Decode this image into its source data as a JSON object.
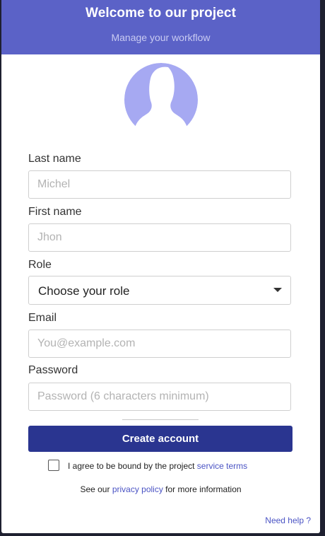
{
  "header": {
    "title": "Welcome to our project",
    "subtitle": "Manage your workflow"
  },
  "avatar": {
    "icon": "user-silhouette-icon",
    "color": "#a6a9f2"
  },
  "form": {
    "last_name": {
      "label": "Last name",
      "placeholder": "Michel"
    },
    "first_name": {
      "label": "First name",
      "placeholder": "Jhon"
    },
    "role": {
      "label": "Role",
      "selected": "Choose your role"
    },
    "email": {
      "label": "Email",
      "placeholder": "You@example.com"
    },
    "password": {
      "label": "Password",
      "placeholder": "Password (6 characters minimum)"
    }
  },
  "submit": {
    "label": "Create account"
  },
  "terms": {
    "text": "I agree to be bound by the project ",
    "link": "service terms"
  },
  "privacy": {
    "prefix": "See our ",
    "link": "privacy policy",
    "suffix": " for more information"
  },
  "help": {
    "label": "Need help ?"
  },
  "colors": {
    "header_bg": "#5b62c7",
    "button_bg": "#2a3590",
    "link": "#4a53c4"
  }
}
